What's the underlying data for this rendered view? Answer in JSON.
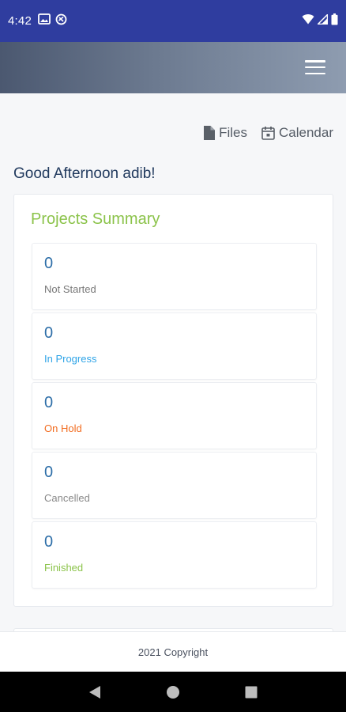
{
  "status_bar": {
    "time": "4:42",
    "icons": [
      "gallery-icon",
      "sync-icon",
      "wifi-icon",
      "signal-icon",
      "battery-icon"
    ]
  },
  "header": {
    "menu_icon": "hamburger-menu-icon"
  },
  "quick_links": [
    {
      "label": "Files",
      "icon": "file-icon"
    },
    {
      "label": "Calendar",
      "icon": "calendar-icon"
    }
  ],
  "greeting": "Good Afternoon adib!",
  "summary": {
    "title": "Projects Summary",
    "stats": [
      {
        "value": "0",
        "label": "Not Started",
        "color": "#777777"
      },
      {
        "value": "0",
        "label": "In Progress",
        "color": "#2fa4e7"
      },
      {
        "value": "0",
        "label": "On Hold",
        "color": "#f26d21"
      },
      {
        "value": "0",
        "label": "Cancelled",
        "color": "#888888"
      },
      {
        "value": "0",
        "label": "Finished",
        "color": "#8bc34a"
      }
    ]
  },
  "footer": {
    "text": "2021 Copyright"
  },
  "nav_bar": {
    "buttons": [
      "back-icon",
      "home-icon",
      "recents-icon"
    ]
  },
  "colors": {
    "status_bar": "#2f3d9f",
    "title_green": "#8bc34a",
    "value_blue": "#2d6ea8",
    "greeting": "#213a5e"
  }
}
